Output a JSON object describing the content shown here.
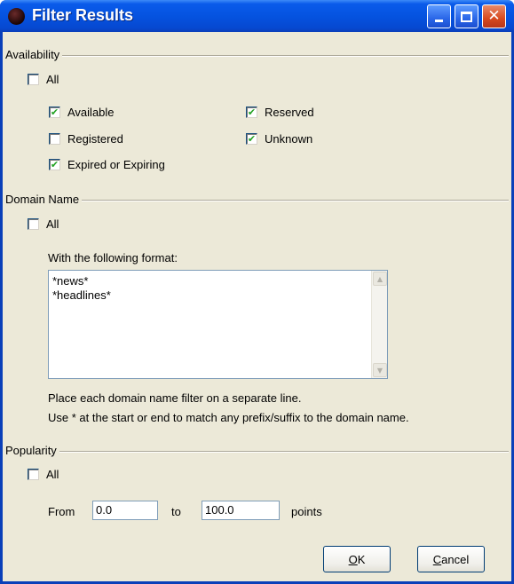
{
  "window": {
    "title": "Filter Results",
    "title_bar_color": "#0553e0"
  },
  "availability": {
    "label": "Availability",
    "all": {
      "label": "All",
      "checked": false
    },
    "options": [
      {
        "label": "Available",
        "checked": true
      },
      {
        "label": "Reserved",
        "checked": true
      },
      {
        "label": "Registered",
        "checked": false
      },
      {
        "label": "Unknown",
        "checked": true
      },
      {
        "label": "Expired or Expiring",
        "checked": true
      }
    ]
  },
  "domain_name": {
    "label": "Domain Name",
    "all": {
      "label": "All",
      "checked": false
    },
    "format_label": "With the following format:",
    "filters": "*news*\n*headlines*",
    "help_line_1": "Place each domain name filter on a separate line.",
    "help_line_2": "Use * at the start or end to match any prefix/suffix to the domain name."
  },
  "popularity": {
    "label": "Popularity",
    "all": {
      "label": "All",
      "checked": false
    },
    "from_label": "From",
    "from_value": "0.0",
    "to_label": "to",
    "to_value": "100.0",
    "unit_label": "points"
  },
  "buttons": {
    "ok_accel": "O",
    "ok_rest": "K",
    "cancel_accel": "C",
    "cancel_rest": "ancel"
  },
  "icons": {
    "check": "check-mark-icon",
    "app": "app-icon",
    "minimize": "minimize-icon",
    "maximize": "maximize-icon",
    "close": "close-icon",
    "scroll_up": "scroll-up-arrow-icon",
    "scroll_down": "scroll-down-arrow-icon"
  }
}
